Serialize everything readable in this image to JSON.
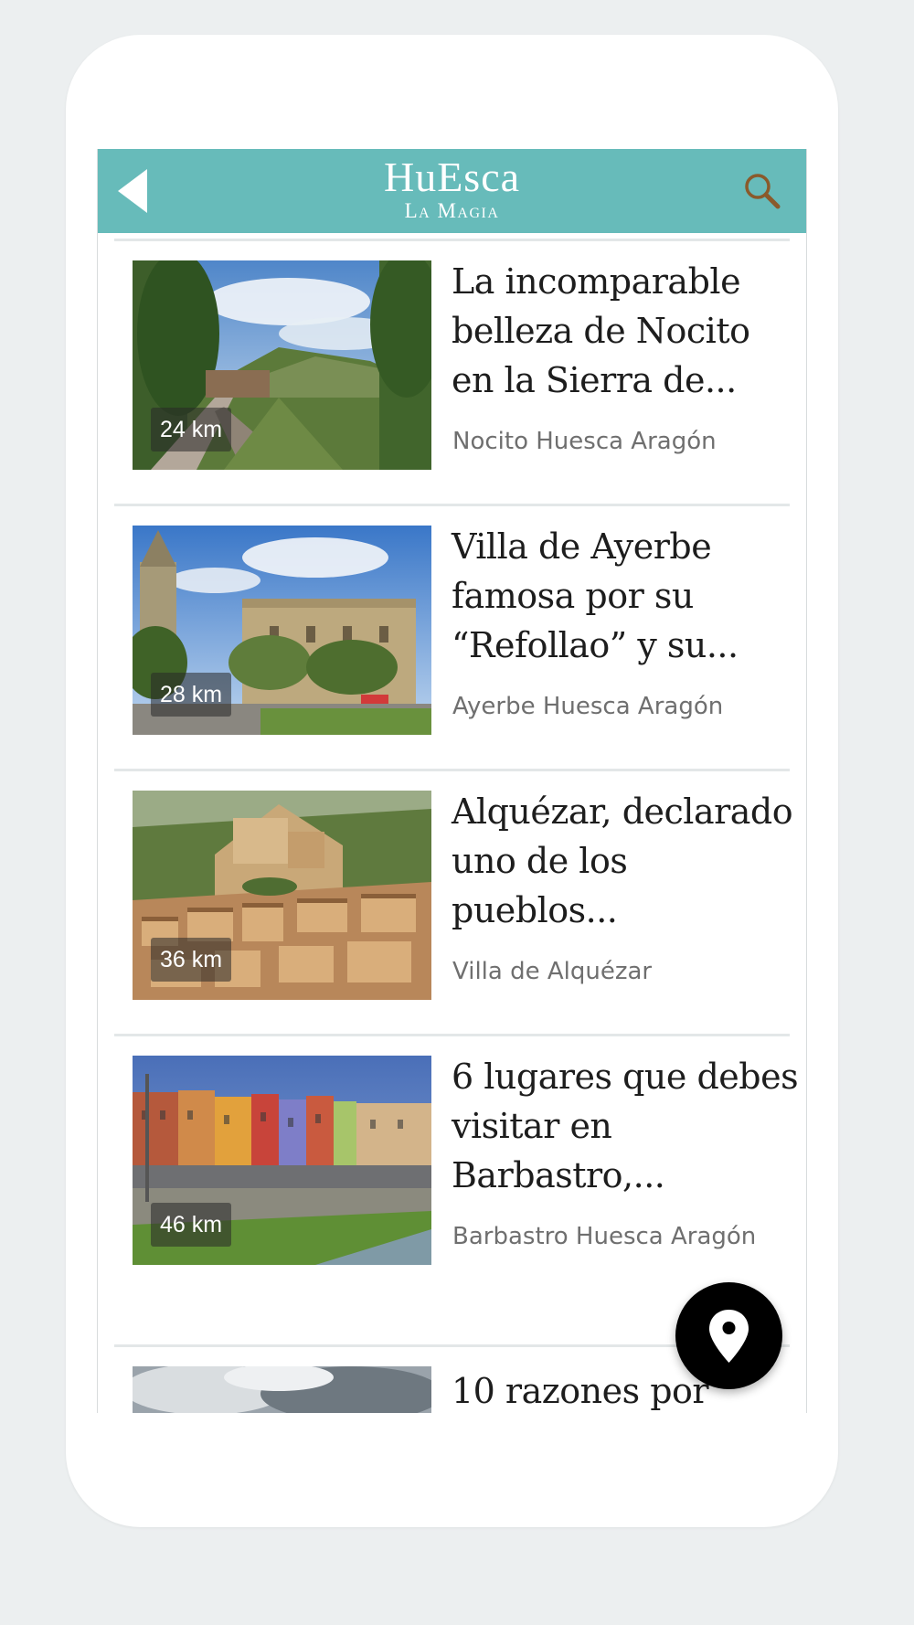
{
  "header": {
    "logo_main": "HuEsca",
    "logo_sub": "La Magia",
    "background_color": "#67bbba",
    "back_icon": "back-arrow-icon",
    "search_icon": "search-icon"
  },
  "articles": [
    {
      "distance": "24 km",
      "title": "La incomparable belleza de Nocito en la Sierra de...",
      "location": "Nocito Huesca Aragón"
    },
    {
      "distance": "28 km",
      "title": "Villa de Ayerbe famosa por su “Refollao” y su...",
      "location": "Ayerbe Huesca Aragón"
    },
    {
      "distance": "36 km",
      "title": "Alquézar, declarado uno de los pueblos...",
      "location": "Villa de Alquézar"
    },
    {
      "distance": "46 km",
      "title": "6 lugares que debes visitar en Barbastro,...",
      "location": "Barbastro Huesca Aragón"
    },
    {
      "title": "10 razones por"
    }
  ],
  "fab": {
    "icon": "map-pin-icon",
    "color": "#000000"
  }
}
